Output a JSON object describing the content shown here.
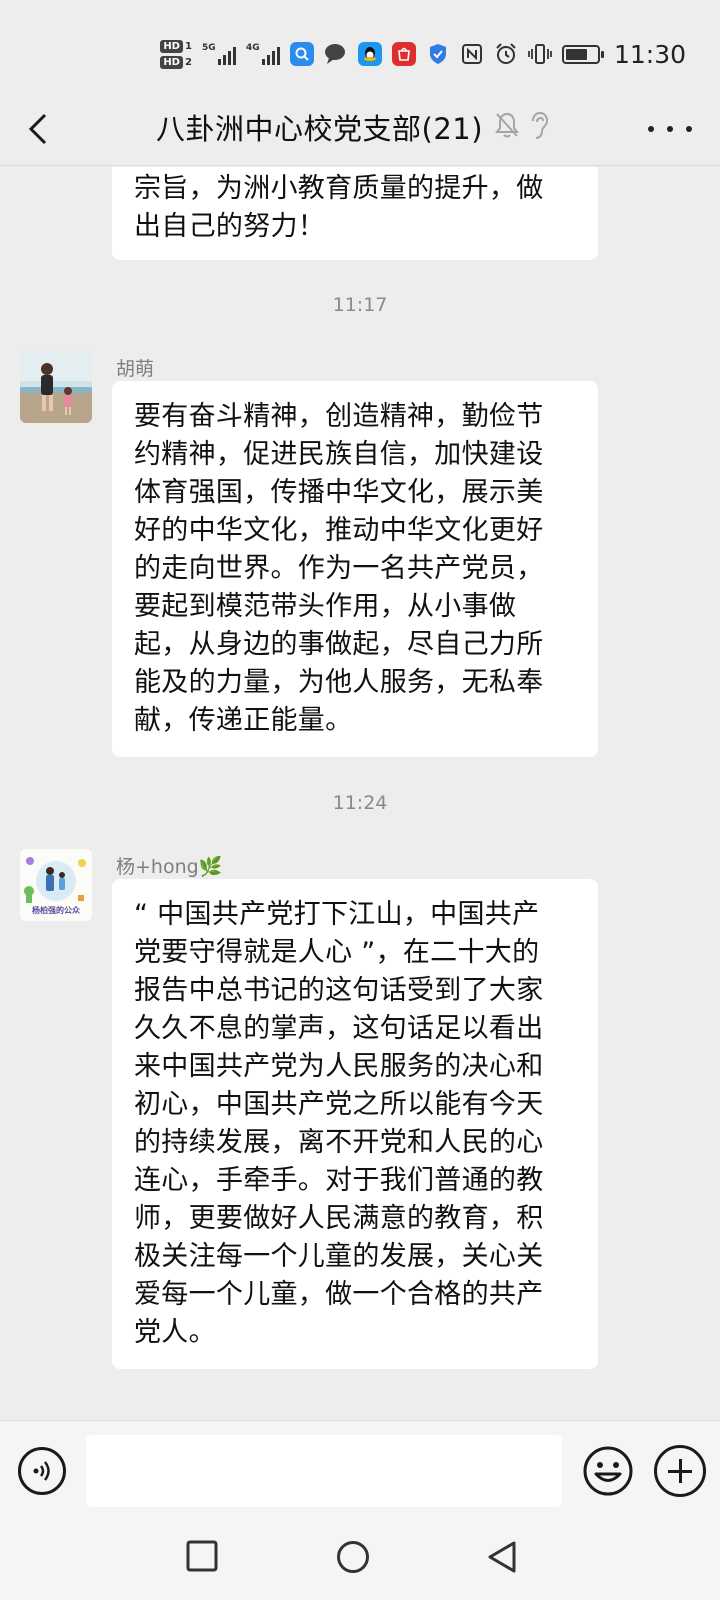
{
  "status_bar": {
    "time": "11:30",
    "sim1_label": "HD",
    "sim1_index": "1",
    "sim2_label": "HD",
    "sim2_index": "2",
    "network1": "5G",
    "network2": "4G",
    "battery_level": 0.7,
    "icons": [
      "search-app-icon",
      "chat-app-icon",
      "qq-app-icon",
      "store-app-icon",
      "shield-app-icon",
      "nfc-icon",
      "alarm-icon",
      "vibrate-icon",
      "battery-icon"
    ]
  },
  "header": {
    "title": "八卦洲中心校党支部(21)"
  },
  "messages": [
    {
      "sender": "",
      "lines": [
        "宗旨，为洲小教育质量的提升，做",
        "出自己的努力！"
      ]
    },
    {
      "time": "11:17",
      "sender": "胡萌",
      "lines": [
        "要有奋斗精神，创造精神，勤俭节",
        "约精神，促进民族自信，加快建设",
        "体育强国，传播中华文化，展示美",
        "好的中华文化，推动中华文化更好",
        "的走向世界。作为一名共产党员，",
        "要起到模范带头作用，从小事做",
        "起，从身边的事做起，尽自己力所",
        "能及的力量，为他人服务，无私奉",
        "献，传递正能量。"
      ]
    },
    {
      "time": "11:24",
      "sender": "杨+hong",
      "sender_suffix": "🌿",
      "avatar_text": "杨柏强的公众",
      "lines": [
        "“ 中国共产党打下江山，中国共产",
        "党要守得就是人心 ”，在二十大的",
        "报告中总书记的这句话受到了大家",
        "久久不息的掌声，这句话足以看出",
        "来中国共产党为人民服务的决心和",
        "初心，中国共产党之所以能有今天",
        "的持续发展，离不开党和人民的心",
        "连心，手牵手。对于我们普通的教",
        "师，更要做好人民满意的教育，积",
        "极关注每一个儿童的发展，关心关",
        "爱每一个儿童，做一个合格的共产",
        "党人。"
      ]
    }
  ],
  "input": {
    "value": "",
    "placeholder": ""
  },
  "colors": {
    "background": "#ededed",
    "bubble": "#ffffff",
    "timestamp": "#8a8a8a",
    "sender_name": "#7f7f7f"
  }
}
